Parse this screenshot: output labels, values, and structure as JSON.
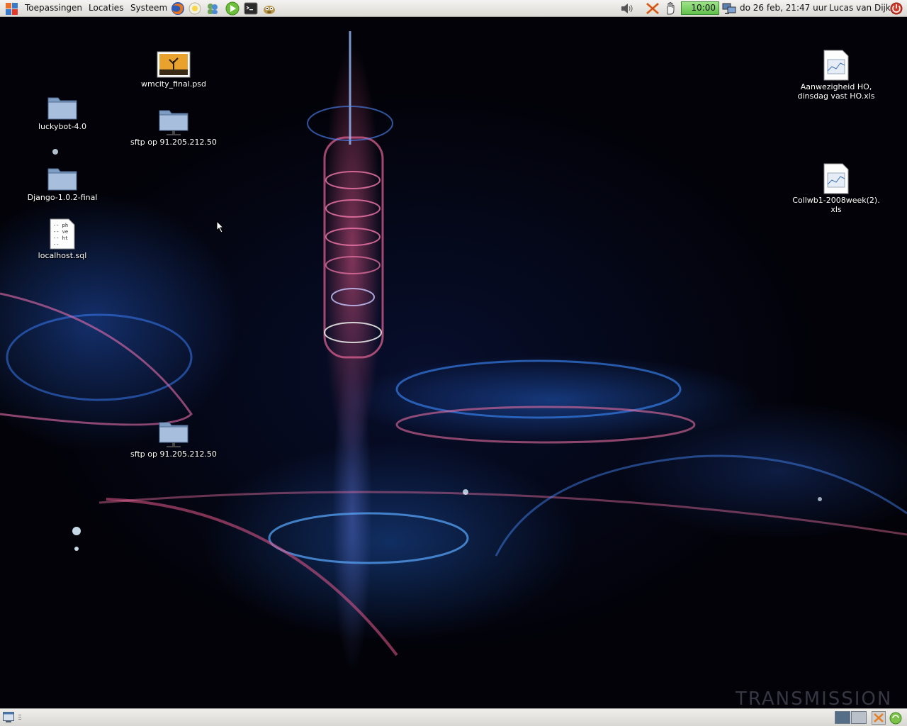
{
  "top_panel": {
    "menus": [
      "Toepassingen",
      "Locaties",
      "Systeem"
    ],
    "launchers": [
      "firefox-icon",
      "evolution-icon",
      "pidgin-icon",
      "media-player-icon",
      "terminal-icon",
      "gimp-icon"
    ],
    "tray": {
      "volume_icon": "volume-icon",
      "apt_clock": "10:00",
      "datetime": "do 26 feb, 21:47 uur",
      "user": "Lucas van Dijk"
    }
  },
  "desktop": {
    "icons": [
      {
        "label": "wmcity_final.psd",
        "type": "image"
      },
      {
        "label": "luckybot-4.0",
        "type": "folder"
      },
      {
        "label": "sftp op 91.205.212.50",
        "type": "network-folder"
      },
      {
        "label": "Django-1.0.2-final",
        "type": "folder"
      },
      {
        "label": "localhost.sql",
        "type": "text"
      },
      {
        "label": "sftp op 91.205.212.50",
        "type": "network-folder"
      },
      {
        "label": "Aanwezigheid HO,\ndinsdag vast HO.xls",
        "type": "spreadsheet"
      },
      {
        "label": "Collwb1-2008week(2).\nxls",
        "type": "spreadsheet"
      }
    ],
    "sql_preview": [
      "-- ph",
      "-- ve",
      "-- ht",
      "--"
    ],
    "watermark": "TRANSMISSION II"
  },
  "colors": {
    "panel_bg": "#e6e4e0",
    "desktop_bg": "#020208",
    "accent_blue": "#2d6fe0",
    "accent_pink": "#e65a8c",
    "clock_green": "#61c24a"
  }
}
